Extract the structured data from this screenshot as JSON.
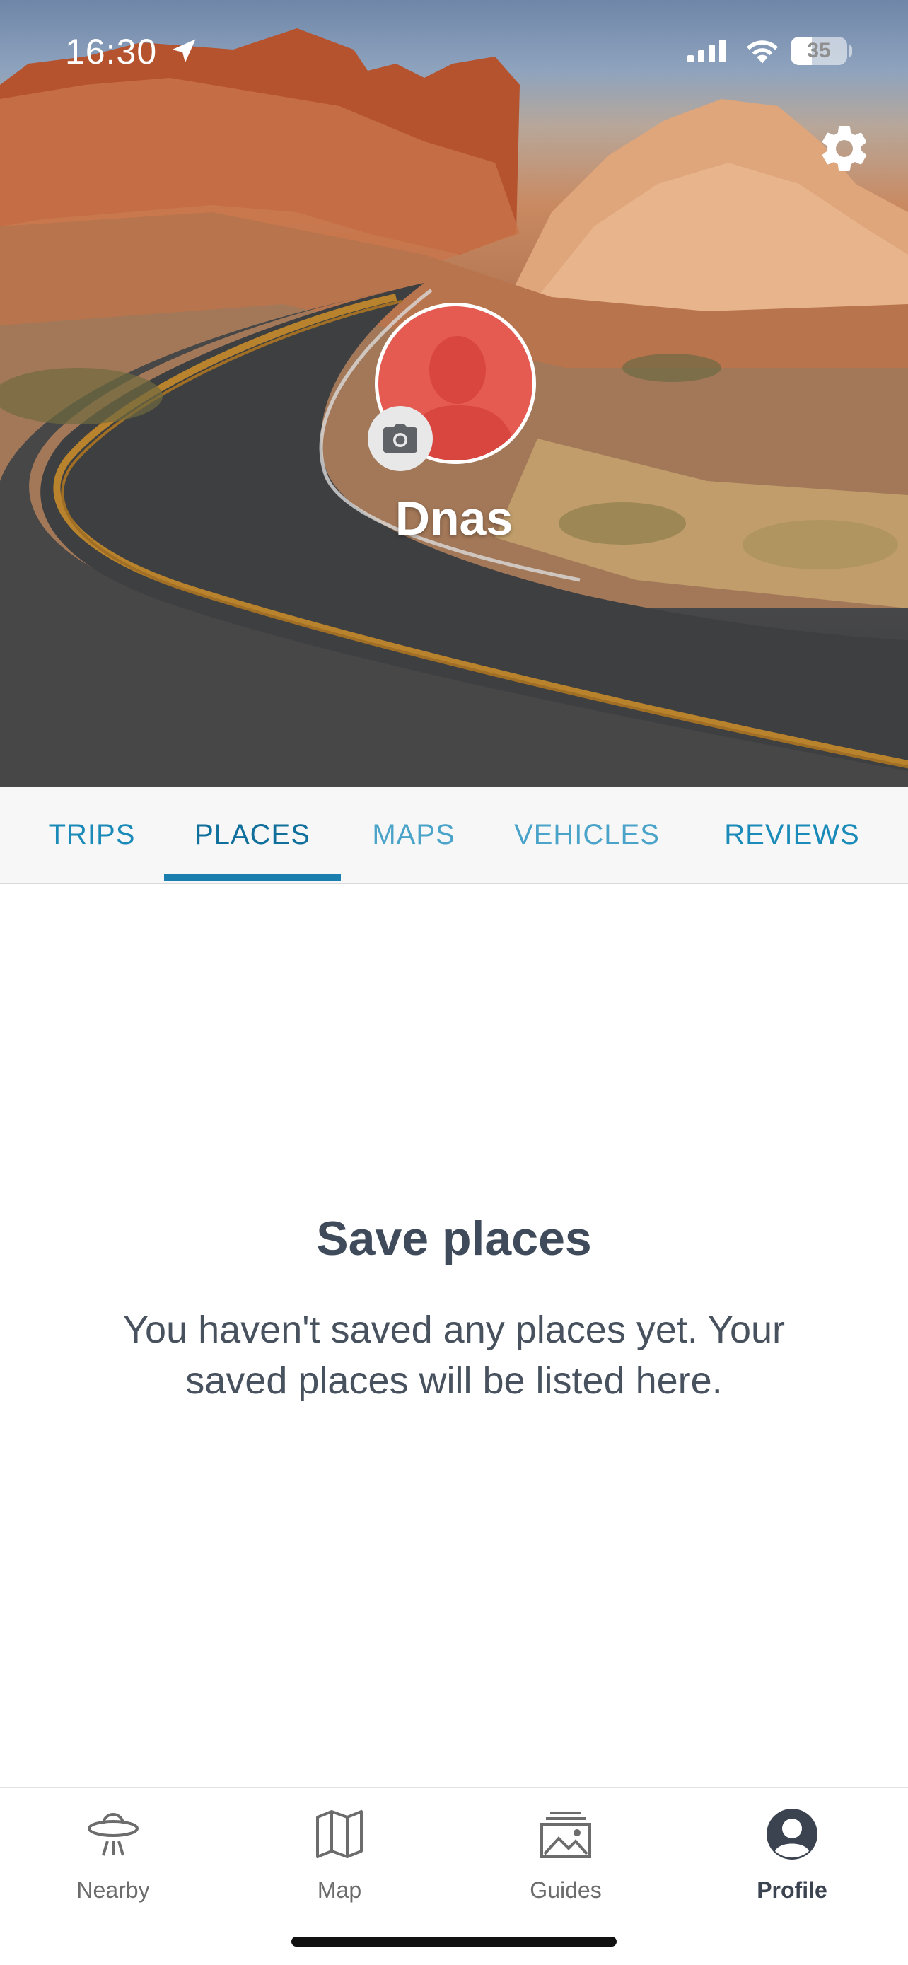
{
  "status_bar": {
    "time": "16:30",
    "battery": "35"
  },
  "profile": {
    "username": "Dnas"
  },
  "tabs": [
    {
      "label": "TRIPS",
      "active": false
    },
    {
      "label": "PLACES",
      "active": true
    },
    {
      "label": "MAPS",
      "active": false
    },
    {
      "label": "VEHICLES",
      "active": false
    },
    {
      "label": "REVIEWS",
      "active": false
    }
  ],
  "empty_state": {
    "title": "Save places",
    "message": "You haven't saved any places yet. Your saved places will be listed here."
  },
  "bottom_nav": [
    {
      "label": "Nearby",
      "icon": "ufo-icon",
      "active": false
    },
    {
      "label": "Map",
      "icon": "map-icon",
      "active": false
    },
    {
      "label": "Guides",
      "icon": "guides-icon",
      "active": false
    },
    {
      "label": "Profile",
      "icon": "profile-icon",
      "active": true
    }
  ],
  "colors": {
    "accent": "#1a8ab8",
    "active_tab": "#116f9b",
    "avatar_bg": "#e55b52",
    "text_dark": "#3f4a5a"
  }
}
